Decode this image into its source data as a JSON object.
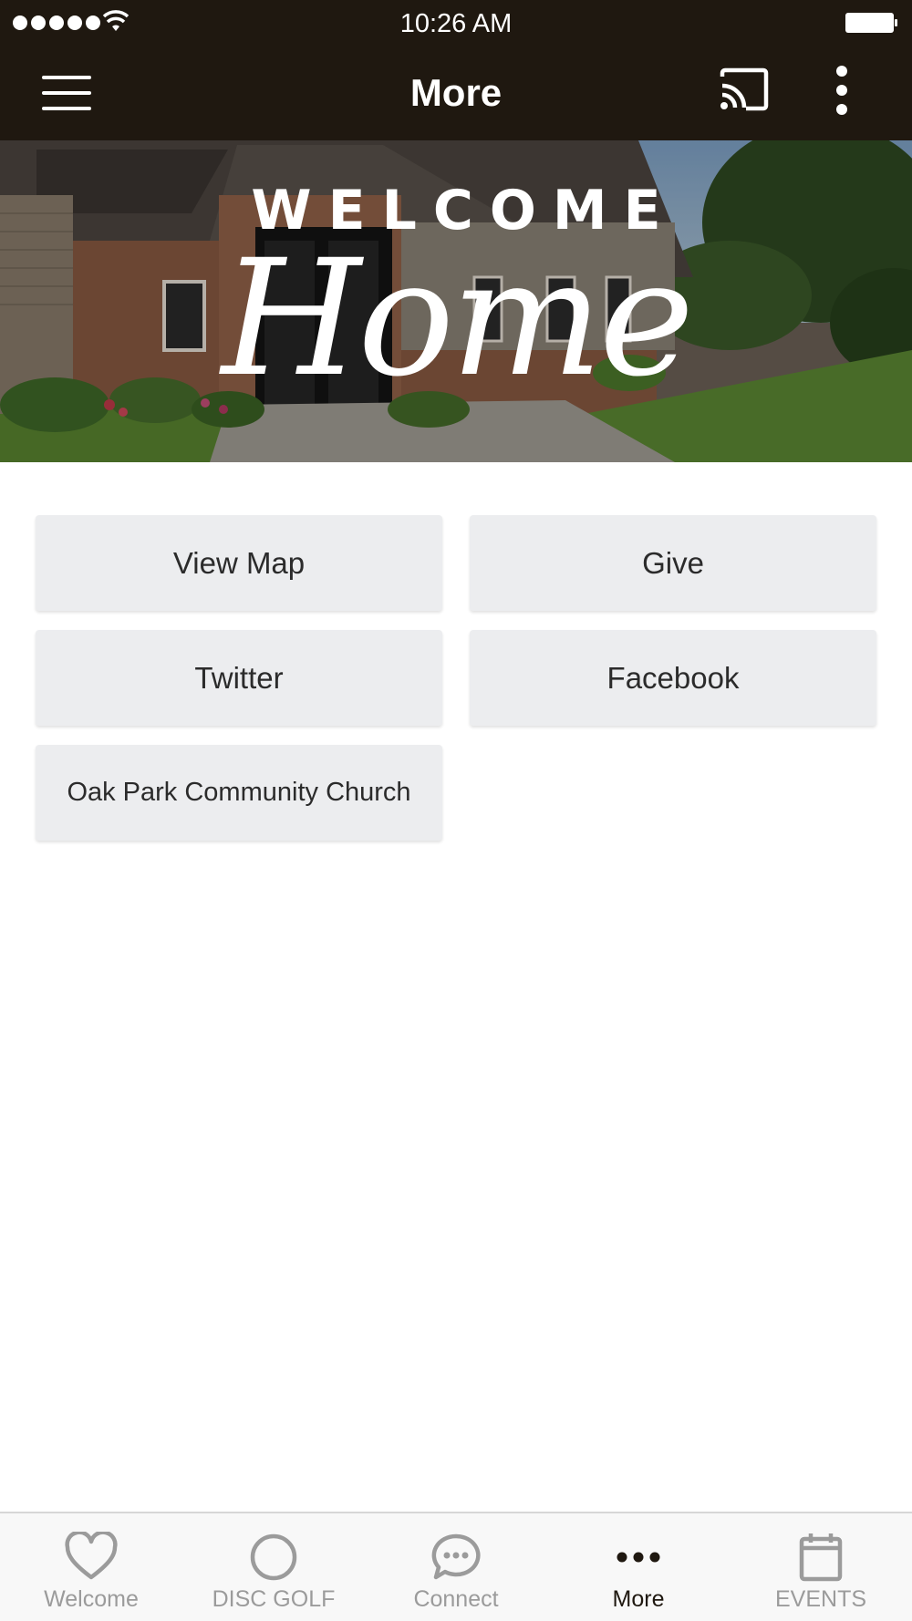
{
  "status_bar": {
    "time": "10:26 AM"
  },
  "app_bar": {
    "title": "More",
    "menu_icon": "hamburger-menu-icon",
    "cast_icon": "cast-icon",
    "overflow_icon": "more-vertical-icon"
  },
  "banner": {
    "welcome_text": "WELCOME",
    "home_text": "Home"
  },
  "links": [
    {
      "label": "View Map"
    },
    {
      "label": "Give"
    },
    {
      "label": "Twitter"
    },
    {
      "label": "Facebook"
    },
    {
      "label": "Oak Park Community Church"
    }
  ],
  "tabs": [
    {
      "label": "Welcome",
      "icon": "heart-icon",
      "active": false
    },
    {
      "label": "DISC GOLF",
      "icon": "circle-icon",
      "active": false
    },
    {
      "label": "Connect",
      "icon": "chat-bubble-icon",
      "active": false
    },
    {
      "label": "More",
      "icon": "more-horizontal-icon",
      "active": true
    },
    {
      "label": "EVENTS",
      "icon": "calendar-icon",
      "active": false
    }
  ],
  "colors": {
    "header_bg": "#1f1810",
    "tile_bg": "#ecedef",
    "tab_inactive": "#9b9b9b",
    "tab_active": "#1f1810"
  }
}
